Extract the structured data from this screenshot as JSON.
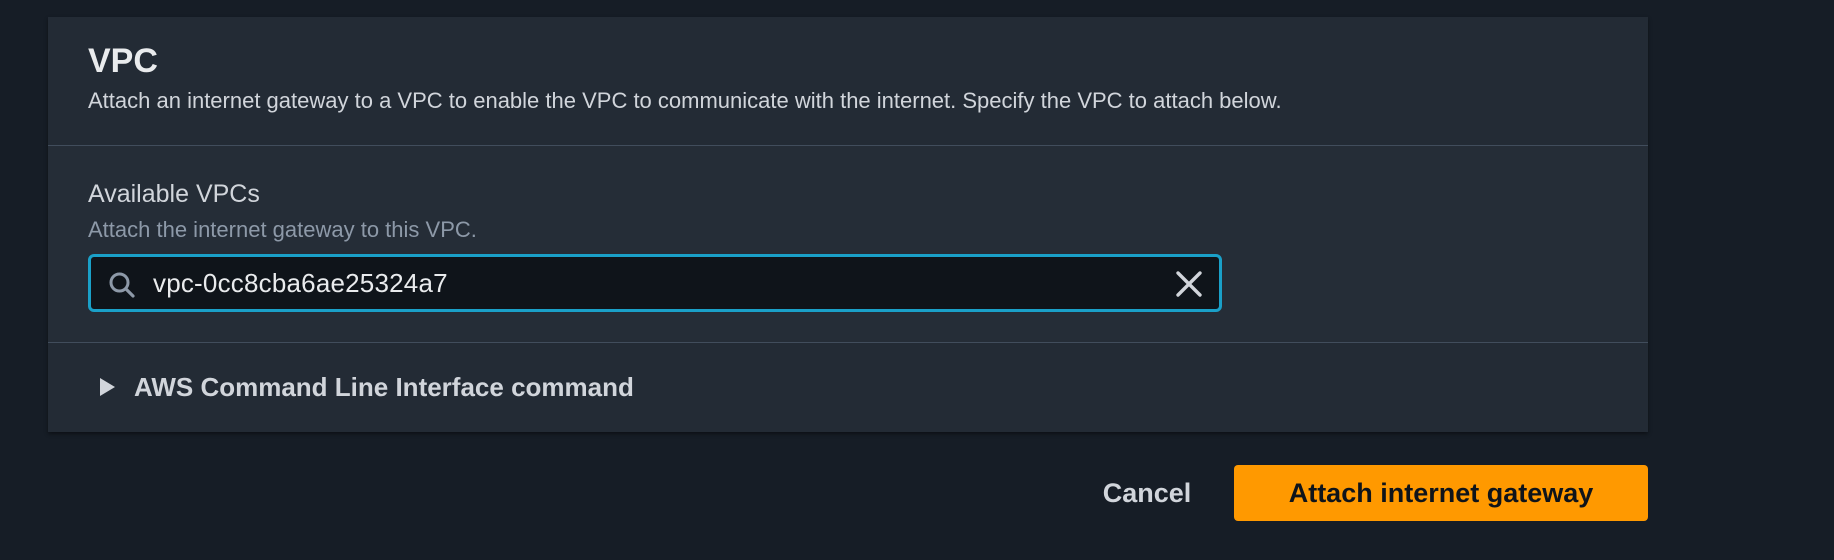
{
  "section": {
    "title": "VPC",
    "description": "Attach an internet gateway to a VPC to enable the VPC to communicate with the internet. Specify the VPC to attach below."
  },
  "vpc_field": {
    "label": "Available VPCs",
    "hint": "Attach the internet gateway to this VPC.",
    "value": "vpc-0cc8cba6ae25324a7",
    "search_icon": "search-icon",
    "clear_icon": "close-icon"
  },
  "cli_expander": {
    "label": "AWS Command Line Interface command",
    "icon": "caret-right-icon"
  },
  "actions": {
    "cancel_label": "Cancel",
    "submit_label": "Attach internet gateway"
  },
  "colors": {
    "page_background": "#161d26",
    "panel_background": "#232b35",
    "input_border_focus": "#1aa0c8",
    "primary_button": "#ff9900"
  }
}
